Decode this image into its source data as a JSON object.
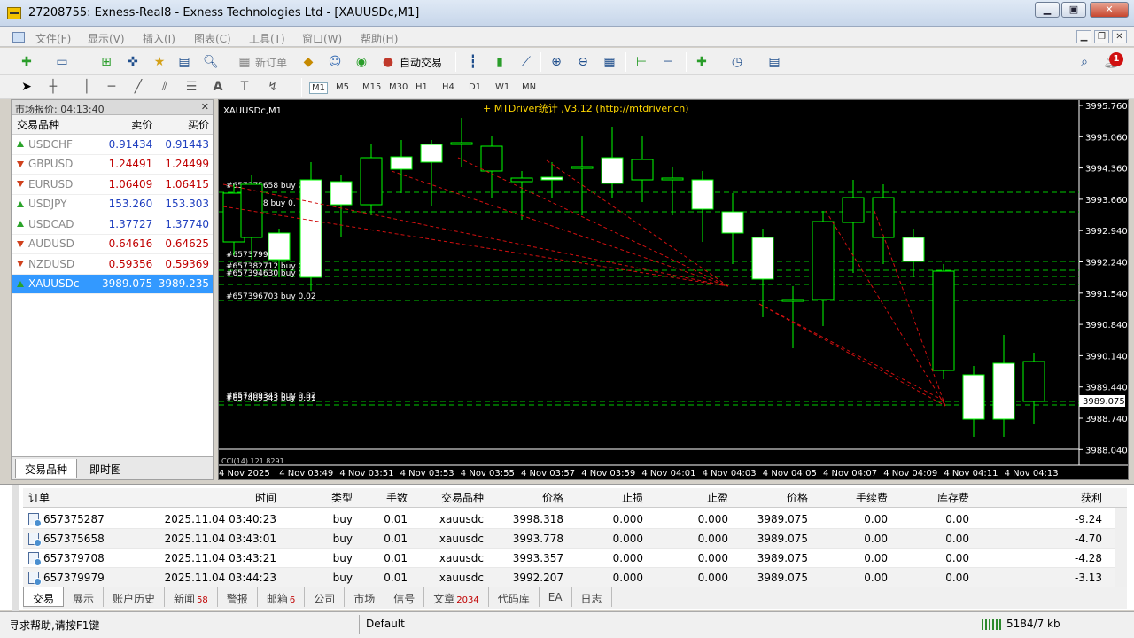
{
  "window": {
    "title": "27208755: Exness-Real8 - Exness Technologies Ltd - [XAUUSDc,M1]"
  },
  "menu": [
    "文件(F)",
    "显示(V)",
    "插入(I)",
    "图表(C)",
    "工具(T)",
    "窗口(W)",
    "帮助(H)"
  ],
  "toolbar": {
    "new_order": "新订单",
    "auto_trade": "自动交易",
    "notify_count": "1",
    "timeframes": [
      "M1",
      "M5",
      "M15",
      "M30",
      "H1",
      "H4",
      "D1",
      "W1",
      "MN"
    ]
  },
  "market_watch": {
    "header": "市场报价: 04:13:40",
    "col_symbol": "交易品种",
    "col_bid": "卖价",
    "col_ask": "买价",
    "rows": [
      {
        "symbol": "USDCHF",
        "bid": "0.91434",
        "ask": "0.91443",
        "dir": "up",
        "color": "#1f3fbf"
      },
      {
        "symbol": "GBPUSD",
        "bid": "1.24491",
        "ask": "1.24499",
        "dir": "down",
        "color": "#c00000"
      },
      {
        "symbol": "EURUSD",
        "bid": "1.06409",
        "ask": "1.06415",
        "dir": "down",
        "color": "#c00000"
      },
      {
        "symbol": "USDJPY",
        "bid": "153.260",
        "ask": "153.303",
        "dir": "up",
        "color": "#1f3fbf"
      },
      {
        "symbol": "USDCAD",
        "bid": "1.37727",
        "ask": "1.37740",
        "dir": "up",
        "color": "#1f3fbf"
      },
      {
        "symbol": "AUDUSD",
        "bid": "0.64616",
        "ask": "0.64625",
        "dir": "down",
        "color": "#c00000"
      },
      {
        "symbol": "NZDUSD",
        "bid": "0.59356",
        "ask": "0.59369",
        "dir": "down",
        "color": "#c00000"
      },
      {
        "symbol": "XAUUSDc",
        "bid": "3989.075",
        "ask": "3989.235",
        "dir": "up",
        "color": "#ffffff",
        "selected": true
      }
    ],
    "tabs": [
      "交易品种",
      "即时图"
    ]
  },
  "chart": {
    "symbol_label": "XAUUSDc,M1",
    "indicator": "MTDriver统计 ,V3.12 (http://mtdriver.cn)",
    "price_tag": "3989.075",
    "sub_label": "CCI(14) 121.8291",
    "y_labels": [
      "3995.760",
      "3995.060",
      "3994.360",
      "3993.660",
      "3992.940",
      "3992.240",
      "3991.540",
      "3990.840",
      "3990.140",
      "3989.440",
      "3988.740",
      "3988.040"
    ],
    "x_labels": [
      "4 Nov 2025",
      "4 Nov 03:49",
      "4 Nov 03:51",
      "4 Nov 03:53",
      "4 Nov 03:55",
      "4 Nov 03:57",
      "4 Nov 03:59",
      "4 Nov 04:01",
      "4 Nov 04:03",
      "4 Nov 04:05",
      "4 Nov 04:07",
      "4 Nov 04:09",
      "4 Nov 04:11",
      "4 Nov 04:13"
    ],
    "order_labels": [
      "#657375658 buy 0.",
      "#6575708 buy 0.",
      "#657379979",
      "#657382712 buy 0.",
      "#657394630 buy 0.02",
      "#657396703 buy 0.02",
      "#657409343 buy 0.02",
      "#657409343 buy 0.01"
    ]
  },
  "terminal": {
    "columns": [
      "订单",
      "时间",
      "类型",
      "手数",
      "交易品种",
      "价格",
      "止损",
      "止盈",
      "价格",
      "手续费",
      "库存费",
      "获利"
    ],
    "rows": [
      [
        "657375287",
        "2025.11.04 03:40:23",
        "buy",
        "0.01",
        "xauusdc",
        "3998.318",
        "0.000",
        "0.000",
        "3989.075",
        "0.00",
        "0.00",
        "-9.24"
      ],
      [
        "657375658",
        "2025.11.04 03:43:01",
        "buy",
        "0.01",
        "xauusdc",
        "3993.778",
        "0.000",
        "0.000",
        "3989.075",
        "0.00",
        "0.00",
        "-4.70"
      ],
      [
        "657379708",
        "2025.11.04 03:43:21",
        "buy",
        "0.01",
        "xauusdc",
        "3993.357",
        "0.000",
        "0.000",
        "3989.075",
        "0.00",
        "0.00",
        "-4.28"
      ],
      [
        "657379979",
        "2025.11.04 03:44:23",
        "buy",
        "0.01",
        "xauusdc",
        "3992.207",
        "0.000",
        "0.000",
        "3989.075",
        "0.00",
        "0.00",
        "-3.13"
      ]
    ],
    "tabs": [
      {
        "label": "交易"
      },
      {
        "label": "展示"
      },
      {
        "label": "账户历史"
      },
      {
        "label": "新闻",
        "n": "58"
      },
      {
        "label": "警报"
      },
      {
        "label": "邮箱",
        "n": "6"
      },
      {
        "label": "公司"
      },
      {
        "label": "市场"
      },
      {
        "label": "信号"
      },
      {
        "label": "文章",
        "n": "2034"
      },
      {
        "label": "代码库"
      },
      {
        "label": "EA"
      },
      {
        "label": "日志"
      }
    ]
  },
  "status": {
    "help": "寻求帮助,请按F1键",
    "profile": "Default",
    "traffic": "5184/7 kb"
  }
}
